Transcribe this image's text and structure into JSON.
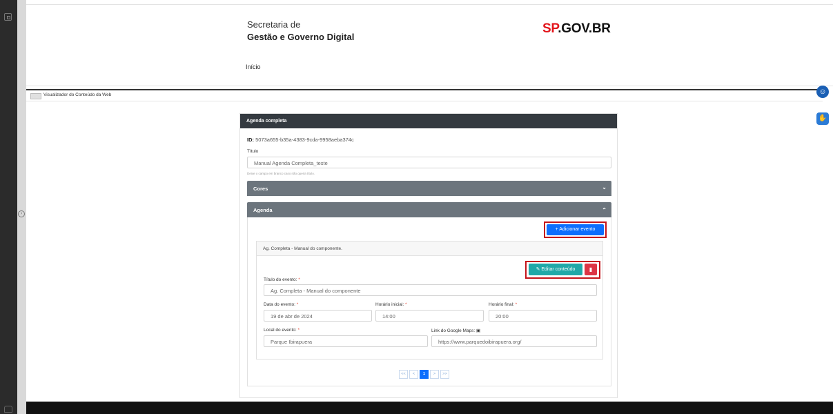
{
  "header": {
    "brand_line1": "Secretaria de",
    "brand_line2": "Gestão e Governo Digital",
    "logo_mark": "SP",
    "logo_text": ".GOV.BR",
    "nav_home": "Início"
  },
  "viewer": {
    "label": "Visualizador do Conteúdo da Web"
  },
  "floating": {
    "accessibility_icon": "accessibility-icon",
    "libras_icon": "libras-hands-icon"
  },
  "card": {
    "title": "Agenda completa",
    "id_label": "ID:",
    "id_value": "5073a655-b35a-4383-9cda-9958aeba374c",
    "title_field_label": "Título",
    "title_field_value": "Manual Agenda Completa_teste",
    "title_hint": "Deixe o campo em branco caso não queira título.",
    "section_cores": "Cores",
    "section_agenda": "Agenda",
    "add_event_button": "+ Adicionar evento",
    "event": {
      "header": "Ag. Completa - Manual do componente.",
      "edit_button": "Editar conteúdo",
      "title_label": "Título do evento:",
      "title_value": "Ag. Completa - Manual do componente",
      "date_label": "Data do evento:",
      "date_value": "19 de abr de 2024",
      "start_label": "Horário inicial:",
      "start_value": "14:00",
      "end_label": "Horário final:",
      "end_value": "20:00",
      "location_label": "Local do evento:",
      "location_value": "Parque Ibirapuera",
      "maps_label": "Link do Google Maps:",
      "maps_value": "https://www.parquedoibirapuera.org/",
      "required_mark": "*"
    },
    "pagination": {
      "first": "<<",
      "prev": "<",
      "current": "1",
      "next": ">",
      "last": ">>"
    }
  },
  "colors": {
    "primary": "#0d6efd",
    "teal": "#20a8a8",
    "danger": "#dc3545",
    "header_dark": "#343a40",
    "accordion": "#6c757d",
    "highlight": "#c4141a"
  }
}
